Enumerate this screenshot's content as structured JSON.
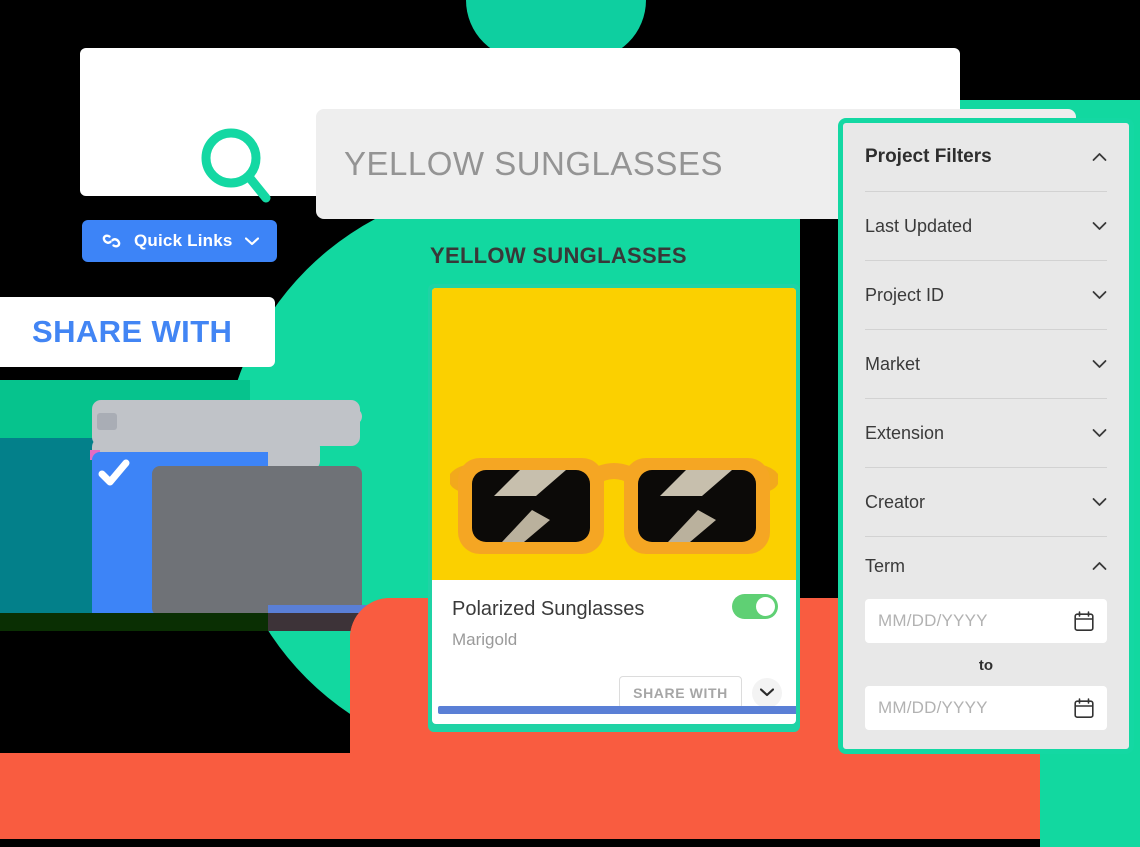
{
  "search": {
    "icon": "search-icon",
    "query_text": "YELLOW SUNGLASSES",
    "placeholder": "YELLOW SUNGLASSES"
  },
  "quick_links": {
    "label": "Quick Links",
    "icon": "link-icon",
    "chevron": "⌄"
  },
  "share_banner": {
    "label": "SHARE WITH"
  },
  "product": {
    "heading": "YELLOW SUNGLASSES",
    "name": "Polarized Sunglasses",
    "subtitle": "Marigold",
    "toggle_on": true,
    "share_button": "SHARE WITH",
    "expand_icon": "chevron-down-icon"
  },
  "filters": {
    "title": "Project Filters",
    "title_chevron": "⌃",
    "rows": [
      {
        "label": "Last Updated",
        "chevron": "⌄",
        "expanded": false
      },
      {
        "label": "Project ID",
        "chevron": "⌄",
        "expanded": false
      },
      {
        "label": "Market",
        "chevron": "⌄",
        "expanded": false
      },
      {
        "label": "Extension",
        "chevron": "⌄",
        "expanded": false
      },
      {
        "label": "Creator",
        "chevron": "⌄",
        "expanded": false
      },
      {
        "label": "Term",
        "chevron": "⌃",
        "expanded": true
      }
    ],
    "term": {
      "from_placeholder": "MM/DD/YYYY",
      "from_value": "",
      "to_label": "to",
      "to_placeholder": "MM/DD/YYYY",
      "to_value": "",
      "calendar_icon": "calendar-icon"
    }
  },
  "colors": {
    "teal": "#12d8a0",
    "blue": "#3d84f7",
    "orange": "#f95c40",
    "yellow": "#fbd000",
    "toggle_green": "#5fd074",
    "link_blue": "#4285f4"
  }
}
